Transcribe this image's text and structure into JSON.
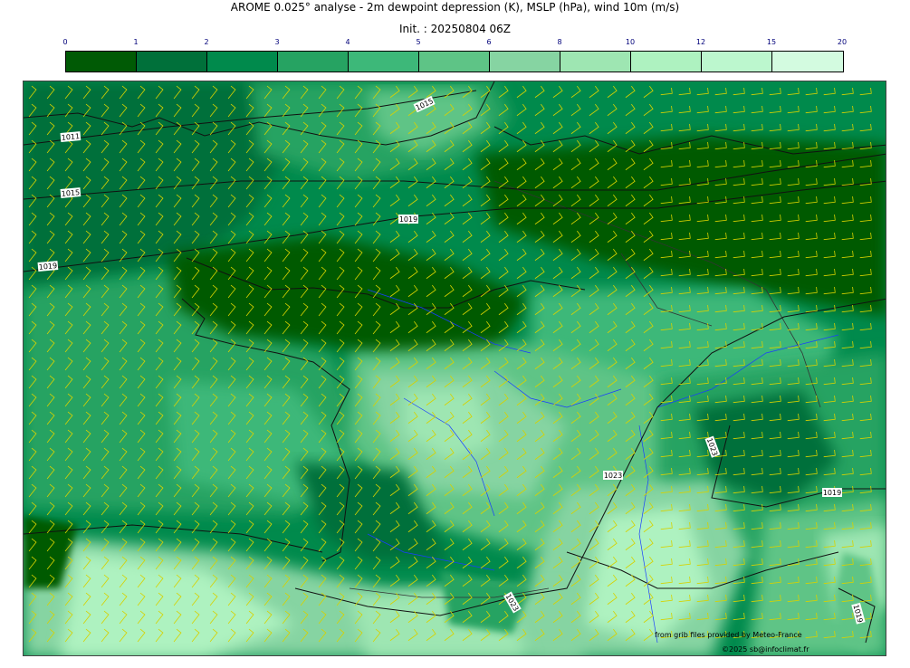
{
  "header": {
    "title": "AROME 0.025° analyse - 2m dewpoint depression (K), MSLP (hPa), wind 10m (m/s)",
    "init": "Init. : 20250804 06Z"
  },
  "colorbar": {
    "ticks": [
      "0",
      "1",
      "2",
      "3",
      "4",
      "5",
      "6",
      "8",
      "10",
      "12",
      "15",
      "20"
    ],
    "colors": [
      "#005a05",
      "#00703a",
      "#008a4c",
      "#26a362",
      "#3db879",
      "#5ec486",
      "#86d4a2",
      "#9ee6b2",
      "#aef2c0",
      "#bcf7ce",
      "#d3fbe0"
    ]
  },
  "map": {
    "isobar_labels": [
      "1015",
      "1011",
      "1015",
      "1019",
      "1019",
      "1023",
      "1023",
      "1019",
      "1023",
      "1019"
    ]
  },
  "credits": {
    "source": "from grib files provided by Meteo-France",
    "copyright": "©2025 sb@infoclimat.fr"
  }
}
